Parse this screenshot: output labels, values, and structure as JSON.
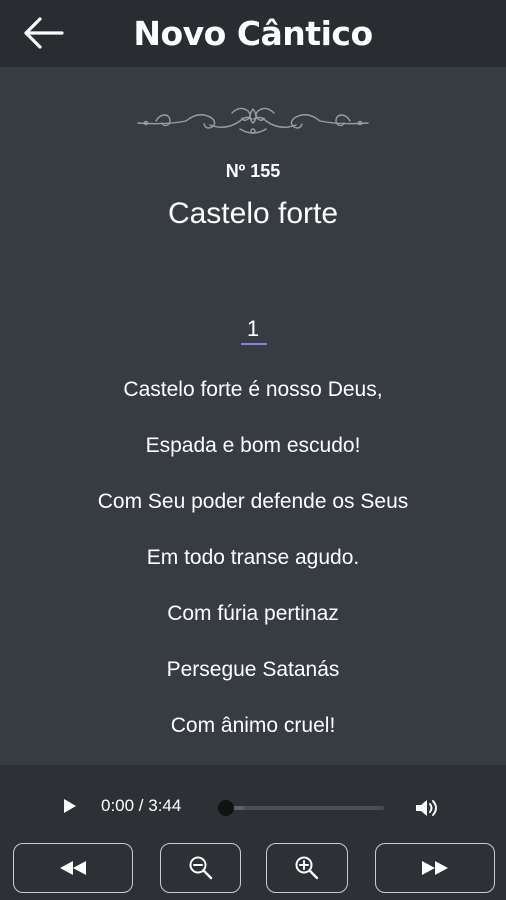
{
  "header": {
    "title": "Novo Cântico",
    "back_icon": "arrow-left-icon"
  },
  "hymn": {
    "number": "Nº 155",
    "title": "Castelo forte",
    "stanza_number": "1",
    "lines": [
      "Castelo forte é nosso Deus,",
      "Espada e bom escudo!",
      "Com Seu poder defende os Seus",
      "Em todo transe agudo.",
      "Com fúria pertinaz",
      "Persegue Satanás",
      "Com ânimo cruel!"
    ]
  },
  "player": {
    "time": "0:00 / 3:44",
    "progress": 0.0,
    "buffered": 0.12
  },
  "controls": [
    {
      "name": "rewind-button",
      "icon": "rewind-icon"
    },
    {
      "name": "zoom-out-button",
      "icon": "zoom-out-icon"
    },
    {
      "name": "zoom-in-button",
      "icon": "zoom-in-icon"
    },
    {
      "name": "fast-forward-button",
      "icon": "fast-forward-icon"
    }
  ],
  "colors": {
    "background": "#373c42",
    "topbar": "#292c31",
    "player_bg": "#2d3035",
    "accent_underline": "#7f86e8"
  }
}
